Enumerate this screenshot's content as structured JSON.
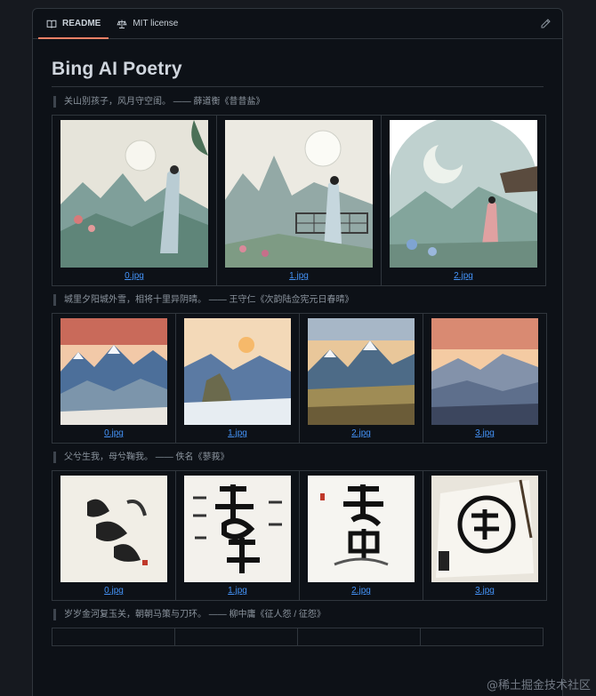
{
  "tabs": [
    {
      "label": "README",
      "icon": "book-icon",
      "active": true
    },
    {
      "label": "MIT license",
      "icon": "scale-icon",
      "active": false
    }
  ],
  "readme": {
    "title": "Bing AI Poetry",
    "sections": [
      {
        "quote": "关山别孩子，风月守空闺。 —— 薛道衡《昔昔盐》",
        "images": [
          "0.jpg",
          "1.jpg",
          "2.jpg"
        ]
      },
      {
        "quote": "城里夕阳城外雪，相将十里异阴晴。 —— 王守仁《次韵陆佥宪元日春晴》",
        "images": [
          "0.jpg",
          "1.jpg",
          "2.jpg",
          "3.jpg"
        ]
      },
      {
        "quote": "父兮生我，母兮鞠我。 —— 佚名《蓼莪》",
        "images": [
          "0.jpg",
          "1.jpg",
          "2.jpg",
          "3.jpg"
        ]
      },
      {
        "quote": "岁岁金河复玉关，朝朝马策与刀环。 —— 柳中庸《征人怨 / 征怨》"
      }
    ]
  },
  "watermark": "@稀土掘金技术社区",
  "colors": {
    "link": "#4493f8",
    "tab_underline": "#f78166",
    "background": "#0d1117",
    "border": "#30363d"
  }
}
